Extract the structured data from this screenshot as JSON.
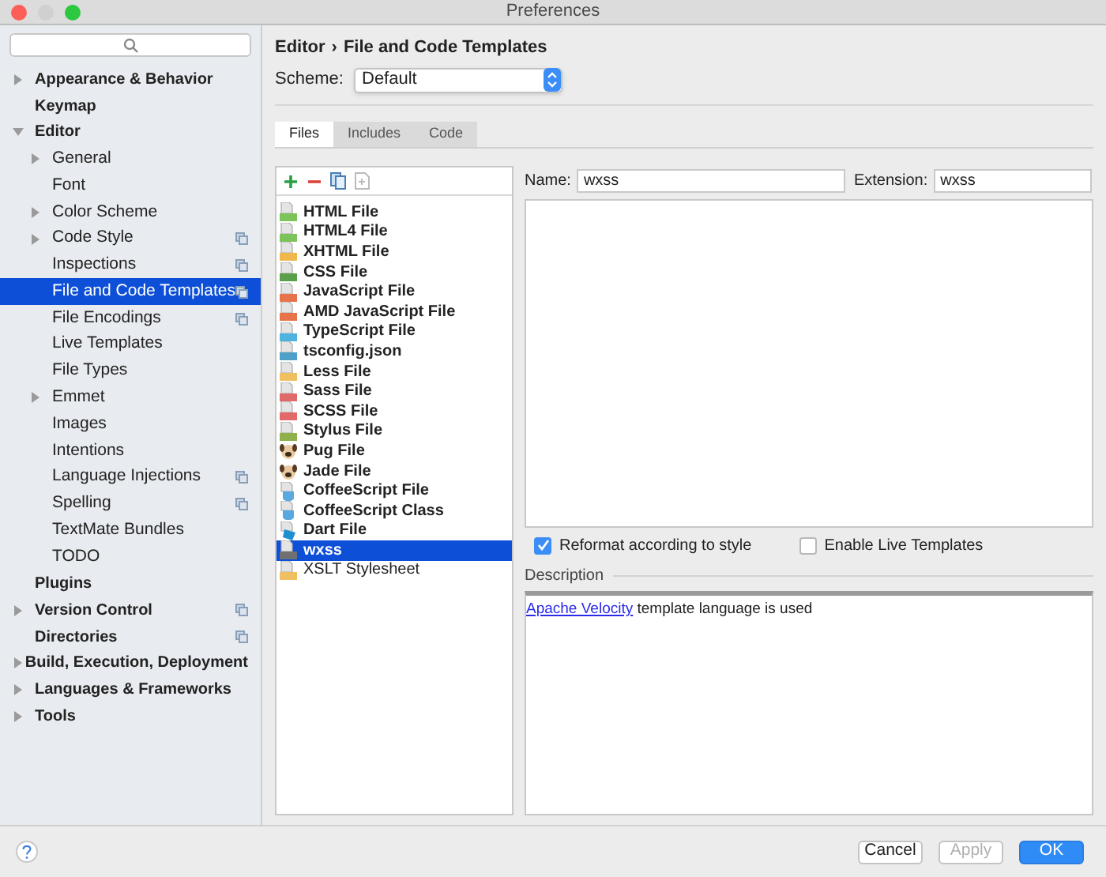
{
  "window": {
    "title": "Preferences"
  },
  "sidebar": {
    "items": [
      {
        "label": "Appearance & Behavior",
        "expanded": false,
        "selected": false,
        "project_icon": false
      },
      {
        "label": "Keymap",
        "selected": false,
        "project_icon": false
      },
      {
        "label": "Editor",
        "expanded": true,
        "selected": false,
        "project_icon": false,
        "children": [
          {
            "label": "General",
            "expanded": false,
            "selected": false,
            "project_icon": false
          },
          {
            "label": "Font",
            "selected": false,
            "project_icon": false
          },
          {
            "label": "Color Scheme",
            "expanded": false,
            "selected": false,
            "project_icon": false
          },
          {
            "label": "Code Style",
            "expanded": false,
            "selected": false,
            "project_icon": true
          },
          {
            "label": "Inspections",
            "selected": false,
            "project_icon": true
          },
          {
            "label": "File and Code Templates",
            "selected": true,
            "project_icon": true
          },
          {
            "label": "File Encodings",
            "selected": false,
            "project_icon": true
          },
          {
            "label": "Live Templates",
            "selected": false,
            "project_icon": false
          },
          {
            "label": "File Types",
            "selected": false,
            "project_icon": false
          },
          {
            "label": "Emmet",
            "expanded": false,
            "selected": false,
            "project_icon": false
          },
          {
            "label": "Images",
            "selected": false,
            "project_icon": false
          },
          {
            "label": "Intentions",
            "selected": false,
            "project_icon": false
          },
          {
            "label": "Language Injections",
            "selected": false,
            "project_icon": true
          },
          {
            "label": "Spelling",
            "selected": false,
            "project_icon": true
          },
          {
            "label": "TextMate Bundles",
            "selected": false,
            "project_icon": false
          },
          {
            "label": "TODO",
            "selected": false,
            "project_icon": false
          }
        ]
      },
      {
        "label": "Plugins",
        "selected": false,
        "project_icon": false
      },
      {
        "label": "Version Control",
        "expanded": false,
        "selected": false,
        "project_icon": true
      },
      {
        "label": "Directories",
        "selected": false,
        "project_icon": true
      },
      {
        "label": "Build, Execution, Deployment",
        "expanded": false,
        "selected": false,
        "project_icon": false
      },
      {
        "label": "Languages & Frameworks",
        "expanded": false,
        "selected": false,
        "project_icon": false
      },
      {
        "label": "Tools",
        "expanded": false,
        "selected": false,
        "project_icon": false
      }
    ]
  },
  "breadcrumb": {
    "parent": "Editor",
    "separator": "›",
    "current": "File and Code Templates"
  },
  "scheme": {
    "label": "Scheme:",
    "value": "Default"
  },
  "tabs": [
    {
      "label": "Files",
      "selected": true
    },
    {
      "label": "Includes",
      "selected": false
    },
    {
      "label": "Code",
      "selected": false
    }
  ],
  "templates": [
    {
      "name": "HTML File",
      "kind": "file",
      "color": "#7cc35a",
      "selected": false
    },
    {
      "name": "HTML4 File",
      "kind": "file",
      "color": "#7cc35a",
      "selected": false
    },
    {
      "name": "XHTML File",
      "kind": "file",
      "color": "#f0b84a",
      "selected": false
    },
    {
      "name": "CSS File",
      "kind": "file",
      "color": "#5aa04a",
      "selected": false
    },
    {
      "name": "JavaScript File",
      "kind": "file",
      "color": "#e8734a",
      "selected": false
    },
    {
      "name": "AMD JavaScript File",
      "kind": "file",
      "color": "#e8734a",
      "selected": false
    },
    {
      "name": "TypeScript File",
      "kind": "file",
      "color": "#4fb3e0",
      "selected": false
    },
    {
      "name": "tsconfig.json",
      "kind": "file",
      "color": "#4fa0c8",
      "selected": false
    },
    {
      "name": "Less File",
      "kind": "file",
      "color": "#f0c060",
      "selected": false
    },
    {
      "name": "Sass File",
      "kind": "file",
      "color": "#e06a6a",
      "selected": false
    },
    {
      "name": "SCSS File",
      "kind": "file",
      "color": "#e06a6a",
      "selected": false
    },
    {
      "name": "Stylus File",
      "kind": "file",
      "color": "#8fb04a",
      "selected": false
    },
    {
      "name": "Pug File",
      "kind": "dog",
      "selected": false
    },
    {
      "name": "Jade File",
      "kind": "dog",
      "selected": false
    },
    {
      "name": "CoffeeScript File",
      "kind": "coffee",
      "selected": false
    },
    {
      "name": "CoffeeScript Class",
      "kind": "coffee",
      "selected": false
    },
    {
      "name": "Dart File",
      "kind": "dart",
      "selected": false
    },
    {
      "name": "wxss",
      "kind": "file",
      "color": "#707070",
      "selected": true
    },
    {
      "name": "XSLT Stylesheet",
      "kind": "file",
      "color": "#f0c060",
      "selected": false
    }
  ],
  "editor": {
    "name_label": "Name:",
    "name_value": "wxss",
    "extension_label": "Extension:",
    "extension_value": "wxss"
  },
  "options": [
    {
      "label": "Reformat according to style",
      "checked": true
    },
    {
      "label": "Enable Live Templates",
      "checked": false
    }
  ],
  "description": {
    "title": "Description",
    "link": "Apache Velocity",
    "text": "template language is used"
  },
  "buttons": [
    {
      "label": "Cancel",
      "kind": "normal",
      "disabled": false
    },
    {
      "label": "Apply",
      "kind": "normal",
      "disabled": true
    },
    {
      "label": "OK",
      "kind": "default",
      "disabled": false
    }
  ]
}
